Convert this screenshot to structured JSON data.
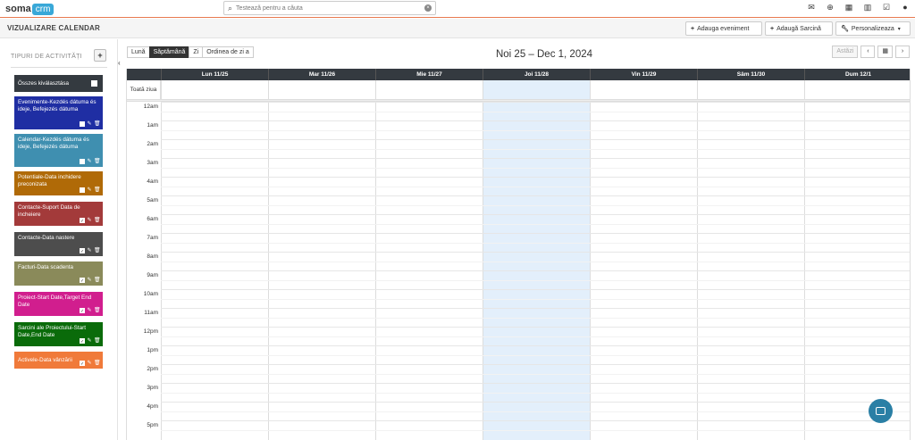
{
  "topbar": {
    "logo_left": "soma",
    "logo_right": "crm",
    "search_placeholder": "Testează pentru a căuta",
    "icons": [
      "envelope-icon",
      "plus-circle-icon",
      "calendar-icon",
      "bar-chart-icon",
      "checkbox-icon",
      "user-icon"
    ]
  },
  "header": {
    "title": "VIZUALIZARE CALENDAR",
    "add_event": "Adauga eveniment",
    "add_task": "Adaugă Sarcină",
    "customize": "Personalizeaza"
  },
  "sidebar": {
    "title": "TIPURI DE ACTIVITĂȚI",
    "add_label": "+",
    "select_all": "Összes kiválasztása",
    "items": [
      {
        "label": "Evenimente-Kezdés dátuma és ideje, Befejezés dátuma",
        "color": "#1f2ea3",
        "checked": false
      },
      {
        "label": "Calendar-Kezdés dátuma és ideje, Befejezés dátuma",
        "color": "#3f8fb0",
        "checked": false
      },
      {
        "label": "Potentiale-Data inchidere preconizata",
        "color": "#b06a07",
        "checked": false
      },
      {
        "label": "Contacte-Suport Data de incheiere",
        "color": "#a33a3a",
        "checked": true
      },
      {
        "label": "Contacte-Data nastere",
        "color": "#4d4d4d",
        "checked": true
      },
      {
        "label": "Facturi-Data scadenta",
        "color": "#8a8a5a",
        "checked": true
      },
      {
        "label": "Proiect-Start Date,Target End Date",
        "color": "#d11e8e",
        "checked": true
      },
      {
        "label": "Sarcini ale Proiectului-Start Date,End Date",
        "color": "#0a6b0a",
        "checked": true
      },
      {
        "label": "Activele-Data vânzării",
        "color": "#f07a3a",
        "checked": true
      }
    ]
  },
  "calendar": {
    "views": [
      "Lună",
      "Săptămână",
      "Zi",
      "Ordinea de zi a"
    ],
    "active_view": "Săptămână",
    "range": "Noi 25 – Dec 1, 2024",
    "today_label": "Astăzi",
    "prev": "‹",
    "next": "›",
    "all_day_label": "Toată ziua",
    "days": [
      "Lun 11/25",
      "Mar 11/26",
      "Mie 11/27",
      "Joi 11/28",
      "Vin 11/29",
      "Sâm 11/30",
      "Dum 12/1"
    ],
    "today_index": 3,
    "hours": [
      "12am",
      "1am",
      "2am",
      "3am",
      "4am",
      "5am",
      "6am",
      "7am",
      "8am",
      "9am",
      "10am",
      "11am",
      "12pm",
      "1pm",
      "2pm",
      "3pm",
      "4pm",
      "5pm"
    ]
  }
}
